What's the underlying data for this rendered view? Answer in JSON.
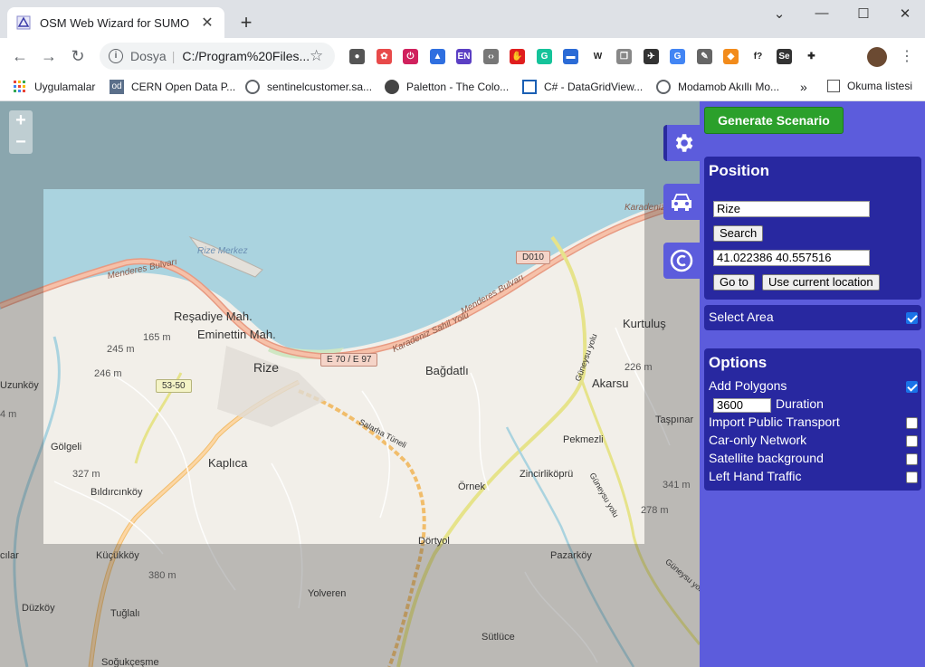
{
  "browser": {
    "tab_title": "OSM Web Wizard for SUMO",
    "new_tab": "+",
    "window": {
      "minimize": "⌄",
      "restore": "—",
      "maximize": "☐",
      "close": "✕"
    },
    "address": {
      "security_label": "Dosya",
      "separator": "|",
      "url": "C:/Program%20Files..."
    },
    "extensions": [
      {
        "name": "bulb-extension-icon",
        "color": "#555555",
        "glyph": "●"
      },
      {
        "name": "color-wheel-extension-icon",
        "color": "#e84a4a",
        "glyph": "✿"
      },
      {
        "name": "power-extension-icon",
        "color": "#d0215d",
        "glyph": "⏻"
      },
      {
        "name": "graduation-extension-icon",
        "color": "#2f6fe0",
        "glyph": "▲"
      },
      {
        "name": "en-extension-icon",
        "color": "#5b3fc4",
        "glyph": "EN"
      },
      {
        "name": "code-extension-icon",
        "color": "#777777",
        "glyph": "‹›"
      },
      {
        "name": "stop-extension-icon",
        "color": "#e01e1e",
        "glyph": "✋"
      },
      {
        "name": "grammarly-extension-icon",
        "color": "#15c39a",
        "glyph": "G"
      },
      {
        "name": "window-extension-icon",
        "color": "#2b6bd6",
        "glyph": "▬"
      },
      {
        "name": "wikipedia-extension-icon",
        "color": "#ffffff",
        "glyph": "W"
      },
      {
        "name": "layers-extension-icon",
        "color": "#888888",
        "glyph": "❐"
      },
      {
        "name": "bird-extension-icon",
        "color": "#333333",
        "glyph": "✈"
      },
      {
        "name": "translate-extension-icon",
        "color": "#4285f4",
        "glyph": "G"
      },
      {
        "name": "eyedropper-extension-icon",
        "color": "#666666",
        "glyph": "✎"
      },
      {
        "name": "shield-extension-icon",
        "color": "#f28b1b",
        "glyph": "◆"
      },
      {
        "name": "formula-extension-icon",
        "color": "#ffffff",
        "glyph": "f?"
      },
      {
        "name": "selenium-extension-icon",
        "color": "#333333",
        "glyph": "Se"
      },
      {
        "name": "puzzle-extension-icon",
        "color": "#ffffff",
        "glyph": "✚"
      }
    ],
    "bookmarks": [
      {
        "label": "Uygulamalar",
        "icon": "apps-grid-icon"
      },
      {
        "label": "CERN Open Data P...",
        "icon": "od-icon"
      },
      {
        "label": "sentinelcustomer.sa...",
        "icon": "globe-icon"
      },
      {
        "label": "Paletton - The Colo...",
        "icon": "palette-icon"
      },
      {
        "label": "C# - DataGridView...",
        "icon": "grid-icon"
      },
      {
        "label": "Modamob Akıllı Mo...",
        "icon": "globe-icon"
      },
      {
        "label": "»",
        "icon": ""
      },
      {
        "label": "Okuma listesi",
        "icon": "reading-list-icon"
      }
    ]
  },
  "map": {
    "zoom_in": "+",
    "zoom_out": "−",
    "labels": {
      "rize_merkez": "Rize Merkez",
      "menderes1": "Menderes Bulvarı",
      "menderes2": "Menderes Bulvarı",
      "karadeniz": "Karadeniz Sahil Yolu",
      "karadeniz2": "Karadeniz",
      "resadiye": "Reşadiye Mah.",
      "eminettin": "Eminettin Mah.",
      "rize": "Rize",
      "bagdatli": "Bağdatlı",
      "kurtulus": "Kurtuluş",
      "akarsu": "Akarsu",
      "uzunkoy": "Uzunköy",
      "golgeli": "Gölgeli",
      "kaplica": "Kaplıca",
      "bildircinkoy": "Bıldırcınköy",
      "pekmezli": "Pekmezli",
      "zincirlikopru": "Zincirliköprü",
      "ornek": "Örnek",
      "tasplnar": "Taşpınar",
      "dortyol": "Dörtyol",
      "kucukkoy": "Küçükköy",
      "pazarkoy": "Pazarköy",
      "yolveren": "Yolveren",
      "duzkoy": "Düzköy",
      "tuglali": "Tuğlalı",
      "sutluce": "Sütlüce",
      "salarha": "Salarha Tüneli",
      "guneysu": "Güneysu yolu",
      "guneysu2": "Güneysu yolu",
      "guneysu3": "Güneysu yolu",
      "h165": "165 m",
      "h245": "245 m",
      "h246": "246 m",
      "h226": "226 m",
      "h327": "327 m",
      "h341": "341 m",
      "h278": "278 m",
      "h380": "380 m",
      "h4m": "4 m",
      "cilar": "cılar",
      "sogukcesme": "Soğukçeşme"
    },
    "shields": {
      "d010": "D010",
      "e70": "E 70 / E 97",
      "r5350": "53-50"
    }
  },
  "panel": {
    "generate_label": "Generate Scenario",
    "position": {
      "title": "Position",
      "search_value": "Rize",
      "search_button": "Search",
      "coords_value": "41.022386 40.557516",
      "goto_button": "Go to",
      "current_button": "Use current location"
    },
    "select_area": {
      "label": "Select Area",
      "checked": true
    },
    "options": {
      "title": "Options",
      "add_polygons": "Add Polygons",
      "duration_value": "3600",
      "duration_label": "Duration",
      "import_pt": "Import Public Transport",
      "car_only": "Car-only Network",
      "satellite": "Satellite background",
      "left_hand": "Left Hand Traffic"
    }
  },
  "colors": {
    "panel_bg": "#5c5cdc",
    "box_bg": "#2828a0",
    "generate_green": "#2ba02b",
    "sea": "#aad3df"
  }
}
